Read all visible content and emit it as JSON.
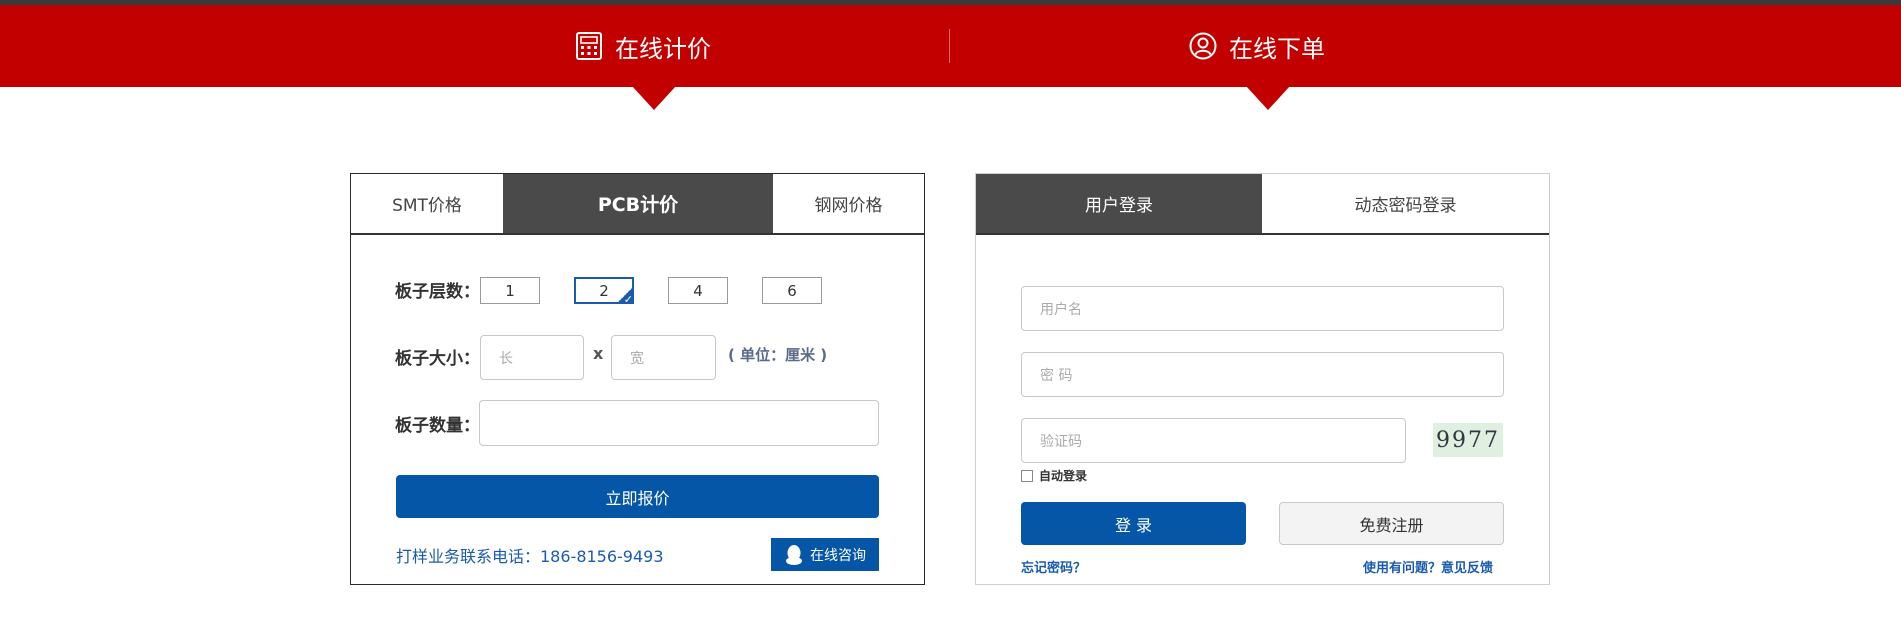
{
  "header": {
    "pricing_tab": "在线计价",
    "order_tab": "在线下单",
    "calculator_icon": "calculator-icon",
    "user_icon": "user-circle-icon",
    "bar_color": "#c30000"
  },
  "pricing": {
    "tabs": [
      {
        "label": "SMT价格",
        "active": false
      },
      {
        "label": "PCB计价",
        "active": true
      },
      {
        "label": "钢网价格",
        "active": false
      }
    ],
    "layers_label": "板子层数：",
    "layers": [
      "1",
      "2",
      "4",
      "6"
    ],
    "selected_layer": "2",
    "size_label": "板子大小：",
    "length_placeholder": "长",
    "width_placeholder": "宽",
    "x_sign": "x",
    "unit": "( 单位：厘米 )",
    "quantity_label": "板子数量：",
    "quantity_value": "",
    "quote_button": "立即报价",
    "phone": "打样业务联系电话：186-8156-9493",
    "consult_button": "在线咨询",
    "consult_icon": "qq-icon"
  },
  "login": {
    "tabs": [
      {
        "label": "用户登录",
        "active": true
      },
      {
        "label": "动态密码登录",
        "active": false
      }
    ],
    "username_placeholder": "用户名",
    "password_placeholder": "密  码",
    "captcha_placeholder": "验证码",
    "captcha_text": "9977",
    "auto_login": "自动登录",
    "login_button": "登  录",
    "register_button": "免费注册",
    "forgot_link": "忘记密码？",
    "feedback_link": "使用有问题？意见反馈",
    "accent_color": "#0556a6"
  }
}
